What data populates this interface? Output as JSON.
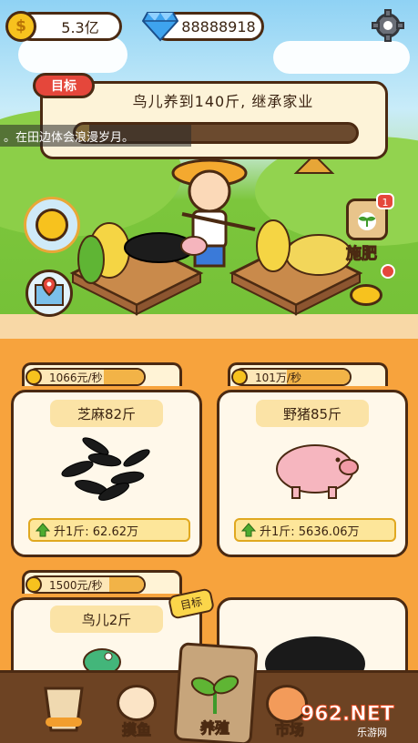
{
  "top_bar": {
    "coin_icon_text": "$",
    "coins": "5.3亿",
    "diamonds": "88888918"
  },
  "goal": {
    "tag": "目标",
    "title": "鸟儿养到140斤, 继承家业",
    "progress_fraction": 0.05
  },
  "ticker": {
    "text": "。在田边体会浪漫岁月。"
  },
  "side_buttons": {
    "fertilize_label": "施肥",
    "fertilize_badge": "1"
  },
  "cards": [
    {
      "rate": "1066元/秒",
      "rate_fill": 0.35,
      "title": "芝麻82斤",
      "upgrade": "升1斤: 62.62万"
    },
    {
      "rate": "101万/秒",
      "rate_fill": 0.55,
      "title": "野猪85斤",
      "upgrade": "升1斤: 5636.06万"
    },
    {
      "rate": "1500元/秒",
      "rate_fill": 0.3,
      "title": "鸟儿2斤",
      "stamp": "目标"
    },
    {
      "rate": "",
      "title": ""
    }
  ],
  "nav": {
    "items": [
      {
        "label": ""
      },
      {
        "label": "摸鱼"
      },
      {
        "label": "养殖"
      },
      {
        "label": "市场"
      },
      {
        "label": ""
      }
    ]
  },
  "watermark": {
    "main": "962.NET",
    "sub": "乐游网"
  },
  "colors": {
    "outline": "#4b2a12",
    "accent_red": "#e5473b",
    "coin_gold": "#f7c21e",
    "panel_orange": "#f7a33d"
  }
}
